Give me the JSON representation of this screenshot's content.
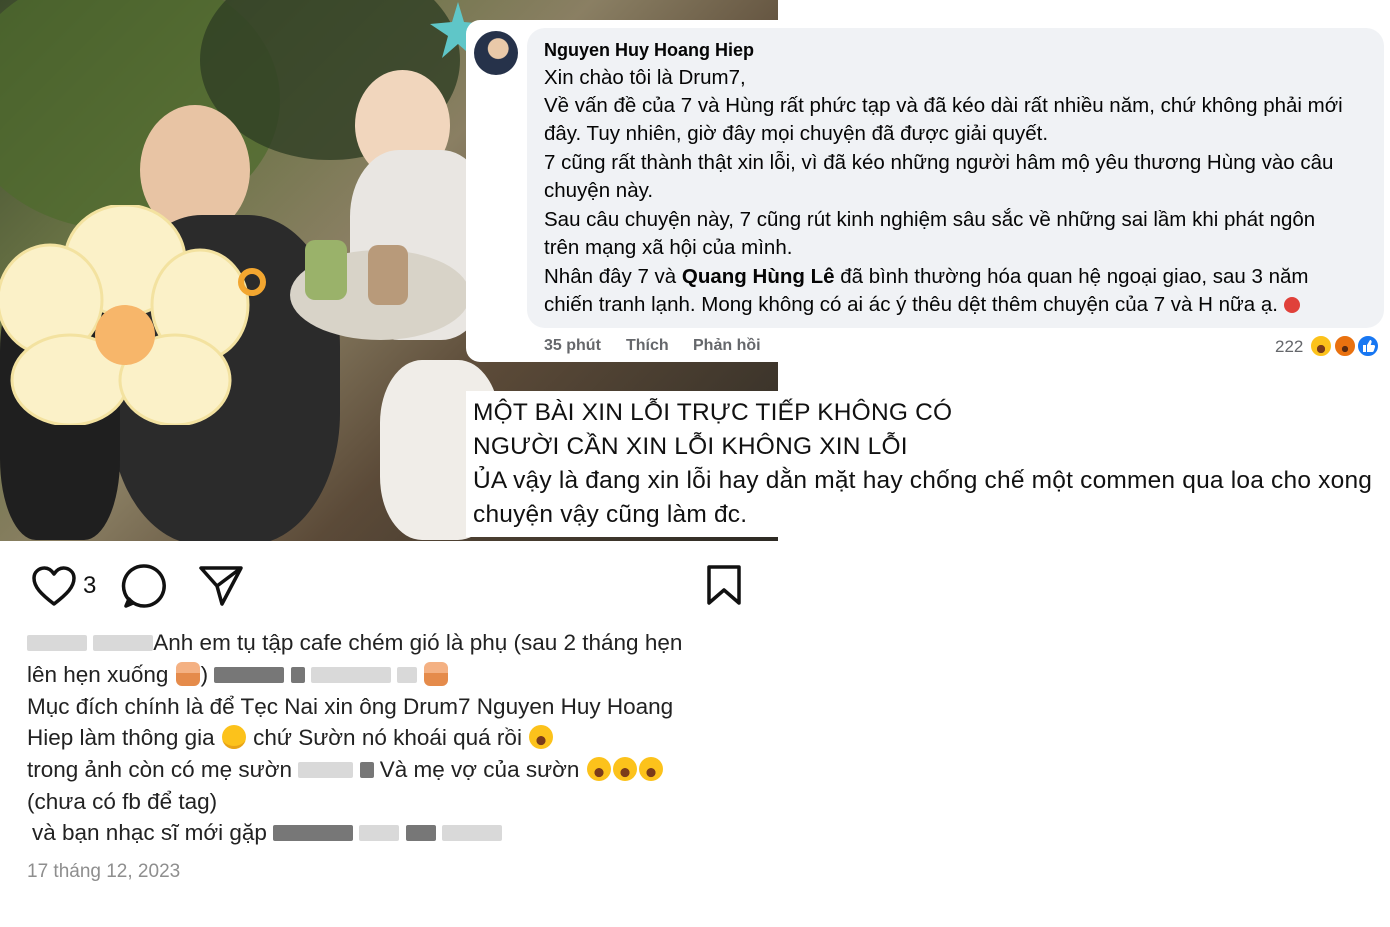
{
  "comment": {
    "author": "Nguyen Huy Hoang Hiep",
    "lines": [
      "Xin chào tôi là Drum7,",
      "Về vấn đề của 7 và Hùng rất phức tạp và đã kéo dài rất nhiều năm, chứ không phải mới",
      "đây. Tuy nhiên, giờ đây mọi chuyện đã được giải quyết.",
      "7 cũng rất thành thật xin lỗi, vì đã kéo những người hâm mộ yêu thương Hùng vào câu",
      "chuyện này.",
      "Sau câu chuyện này, 7 cũng rút kinh nghiệm sâu sắc về những sai lầm khi phát ngôn",
      "trên mạng xã hội của mình."
    ],
    "line8_before": "Nhân đây 7 và ",
    "line8_tag": "Quang Hùng Lê",
    "line8_after": " đã bình thường hóa quan hệ ngoại giao, sau 3 năm",
    "line9": "chiến tranh lạnh. Mong không có ai ác ý thêu dệt thêm chuyện của 7 và H nữa ạ.",
    "time": "35 phút",
    "like_label": "Thích",
    "reply_label": "Phản hồi",
    "reaction_count": "222",
    "reactions": [
      "haha-reaction-icon",
      "angry-reaction-icon",
      "like-reaction-icon"
    ]
  },
  "caption": {
    "lines": [
      "MỘT BÀI XIN LỖI TRỰC TIẾP KHÔNG CÓ",
      "NGƯỜI CẦN XIN LỖI KHÔNG XIN LỖI",
      "ỦA vậy là đang xin lỗi hay dằn mặt hay chống chế một commen qua loa cho xong",
      "chuyện vậy cũng làm đc."
    ]
  },
  "post": {
    "like_count": "3",
    "text": {
      "l1": "Anh em tụ tập cafe chém gió là phụ (sau 2 tháng hẹn",
      "l2": "lên hẹn xuống",
      "l2b": ")",
      "l3": "Mục đích chính là để Tẹc Nai xin ông Drum7 Nguyen Huy Hoang",
      "l4a": "Hiep làm thông gia",
      "l4b": "chứ Sườn nó khoái quá rồi",
      "l5a": "trong ảnh còn có mẹ sườn",
      "l5b": "Và mẹ vợ của sườn",
      "l6": "(chưa có fb để tag)",
      "l7": "và bạn nhạc sĩ mới gặp"
    },
    "date": "17 tháng 12, 2023"
  },
  "colors": {
    "bubble": "#f0f2f5",
    "meta": "#65676b",
    "date": "#8e8e8e"
  }
}
